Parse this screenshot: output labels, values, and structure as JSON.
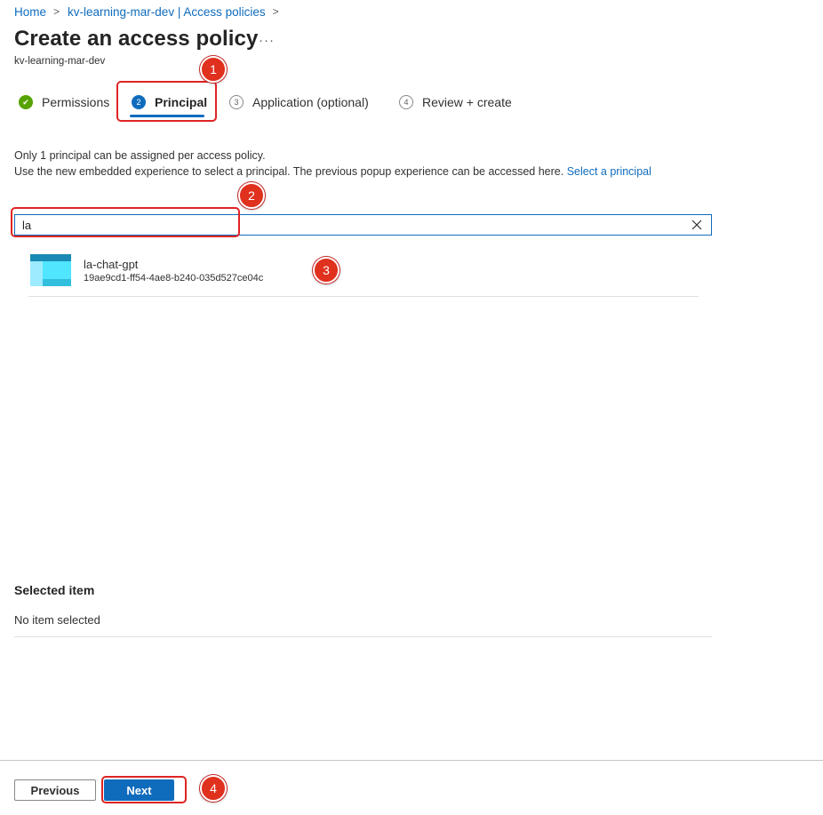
{
  "breadcrumb": {
    "home": "Home",
    "separator": ">",
    "vault": "kv-learning-mar-dev | Access policies",
    "trailing_separator": ">"
  },
  "header": {
    "title": "Create an access policy",
    "more_icon": "···",
    "subtitle": "kv-learning-mar-dev"
  },
  "steps": [
    {
      "number": "✔",
      "label": "Permissions",
      "state": "completed"
    },
    {
      "number": "2",
      "label": "Principal",
      "state": "active"
    },
    {
      "number": "3",
      "label": "Application (optional)",
      "state": "pending"
    },
    {
      "number": "4",
      "label": "Review + create",
      "state": "pending"
    }
  ],
  "info": {
    "line1": "Only 1 principal can be assigned per access policy.",
    "line2": "Use the new embedded experience to select a principal. The previous popup experience can be accessed here.",
    "link": "Select a principal"
  },
  "search": {
    "value": "la",
    "clear_icon": "close-icon"
  },
  "results": [
    {
      "name": "la-chat-gpt",
      "id": "19ae9cd1-ff54-4ae8-b240-035d527ce04c",
      "icon": "app-registration-icon"
    }
  ],
  "selected": {
    "title": "Selected item",
    "empty_text": "No item selected"
  },
  "footer": {
    "previous_label": "Previous",
    "next_label": "Next"
  },
  "annotations": [
    "1",
    "2",
    "3",
    "4"
  ],
  "colors": {
    "accent": "#0f6cbd",
    "success": "#57a300",
    "annotation": "#e0301e"
  }
}
